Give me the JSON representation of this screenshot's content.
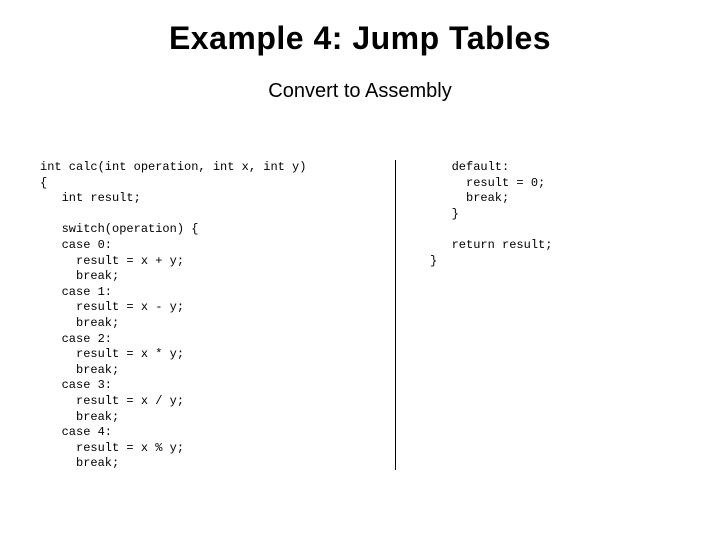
{
  "title": "Example 4: Jump Tables",
  "subtitle": "Convert to Assembly",
  "code_left": "int calc(int operation, int x, int y)\n{\n   int result;\n\n   switch(operation) {\n   case 0:\n     result = x + y;\n     break;\n   case 1:\n     result = x - y;\n     break;\n   case 2:\n     result = x * y;\n     break;\n   case 3:\n     result = x / y;\n     break;\n   case 4:\n     result = x % y;\n     break;",
  "code_right": "   default:\n     result = 0;\n     break;\n   }\n\n   return result;\n}"
}
